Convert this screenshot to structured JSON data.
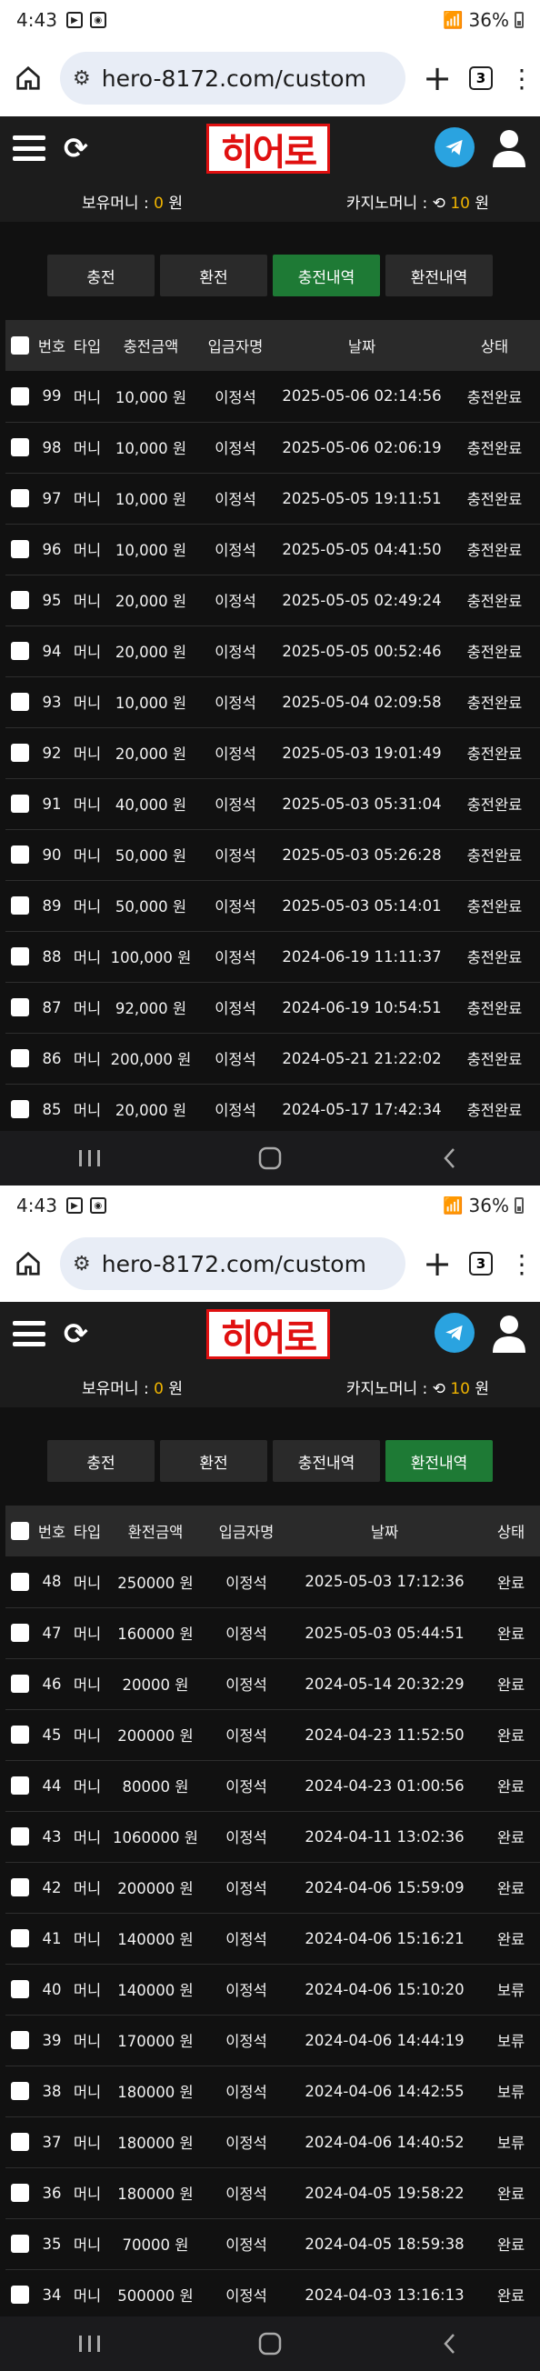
{
  "browser": {
    "time": "4:43",
    "battery": "36%",
    "url": "hero-8172.com/custom",
    "tab_count": "3"
  },
  "site": {
    "logo": "히어로",
    "balance_label": "보유머니 :",
    "balance_value": "0",
    "balance_unit": "원",
    "casino_label": "카지노머니 :",
    "casino_value": "10",
    "casino_unit": "원"
  },
  "tabs": [
    "충전",
    "환전",
    "충전내역",
    "환전내역"
  ],
  "deposit": {
    "headers": [
      "번호",
      "타입",
      "충전금액",
      "입금자명",
      "날짜",
      "상태"
    ],
    "rows": [
      [
        "99",
        "머니",
        "10,000 원",
        "이정석",
        "2025-05-06 02:14:56",
        "충전완료"
      ],
      [
        "98",
        "머니",
        "10,000 원",
        "이정석",
        "2025-05-06 02:06:19",
        "충전완료"
      ],
      [
        "97",
        "머니",
        "10,000 원",
        "이정석",
        "2025-05-05 19:11:51",
        "충전완료"
      ],
      [
        "96",
        "머니",
        "10,000 원",
        "이정석",
        "2025-05-05 04:41:50",
        "충전완료"
      ],
      [
        "95",
        "머니",
        "20,000 원",
        "이정석",
        "2025-05-05 02:49:24",
        "충전완료"
      ],
      [
        "94",
        "머니",
        "20,000 원",
        "이정석",
        "2025-05-05 00:52:46",
        "충전완료"
      ],
      [
        "93",
        "머니",
        "10,000 원",
        "이정석",
        "2025-05-04 02:09:58",
        "충전완료"
      ],
      [
        "92",
        "머니",
        "20,000 원",
        "이정석",
        "2025-05-03 19:01:49",
        "충전완료"
      ],
      [
        "91",
        "머니",
        "40,000 원",
        "이정석",
        "2025-05-03 05:31:04",
        "충전완료"
      ],
      [
        "90",
        "머니",
        "50,000 원",
        "이정석",
        "2025-05-03 05:26:28",
        "충전완료"
      ],
      [
        "89",
        "머니",
        "50,000 원",
        "이정석",
        "2025-05-03 05:14:01",
        "충전완료"
      ],
      [
        "88",
        "머니",
        "100,000 원",
        "이정석",
        "2024-06-19 11:11:37",
        "충전완료"
      ],
      [
        "87",
        "머니",
        "92,000 원",
        "이정석",
        "2024-06-19 10:54:51",
        "충전완료"
      ],
      [
        "86",
        "머니",
        "200,000 원",
        "이정석",
        "2024-05-21 21:22:02",
        "충전완료"
      ],
      [
        "85",
        "머니",
        "20,000 원",
        "이정석",
        "2024-05-17 17:42:34",
        "충전완료"
      ]
    ]
  },
  "withdraw": {
    "headers": [
      "번호",
      "타입",
      "환전금액",
      "입금자명",
      "날짜",
      "상태"
    ],
    "rows": [
      [
        "48",
        "머니",
        "250000 원",
        "이정석",
        "2025-05-03 17:12:36",
        "완료"
      ],
      [
        "47",
        "머니",
        "160000 원",
        "이정석",
        "2025-05-03 05:44:51",
        "완료"
      ],
      [
        "46",
        "머니",
        "20000 원",
        "이정석",
        "2024-05-14 20:32:29",
        "완료"
      ],
      [
        "45",
        "머니",
        "200000 원",
        "이정석",
        "2024-04-23 11:52:50",
        "완료"
      ],
      [
        "44",
        "머니",
        "80000 원",
        "이정석",
        "2024-04-23 01:00:56",
        "완료"
      ],
      [
        "43",
        "머니",
        "1060000 원",
        "이정석",
        "2024-04-11 13:02:36",
        "완료"
      ],
      [
        "42",
        "머니",
        "200000 원",
        "이정석",
        "2024-04-06 15:59:09",
        "완료"
      ],
      [
        "41",
        "머니",
        "140000 원",
        "이정석",
        "2024-04-06 15:16:21",
        "완료"
      ],
      [
        "40",
        "머니",
        "140000 원",
        "이정석",
        "2024-04-06 15:10:20",
        "보류"
      ],
      [
        "39",
        "머니",
        "170000 원",
        "이정석",
        "2024-04-06 14:44:19",
        "보류"
      ],
      [
        "38",
        "머니",
        "180000 원",
        "이정석",
        "2024-04-06 14:42:55",
        "보류"
      ],
      [
        "37",
        "머니",
        "180000 원",
        "이정석",
        "2024-04-06 14:40:52",
        "보류"
      ],
      [
        "36",
        "머니",
        "180000 원",
        "이정석",
        "2024-04-05 19:58:22",
        "완료"
      ],
      [
        "35",
        "머니",
        "70000 원",
        "이정석",
        "2024-04-05 18:59:38",
        "완료"
      ],
      [
        "34",
        "머니",
        "500000 원",
        "이정석",
        "2024-04-03 13:16:13",
        "완료"
      ]
    ]
  },
  "colors": {
    "active_tab": "#1e7a35",
    "logo_red": "#e01010",
    "highlight": "#f0b400",
    "telegram": "#2aa3e0"
  }
}
